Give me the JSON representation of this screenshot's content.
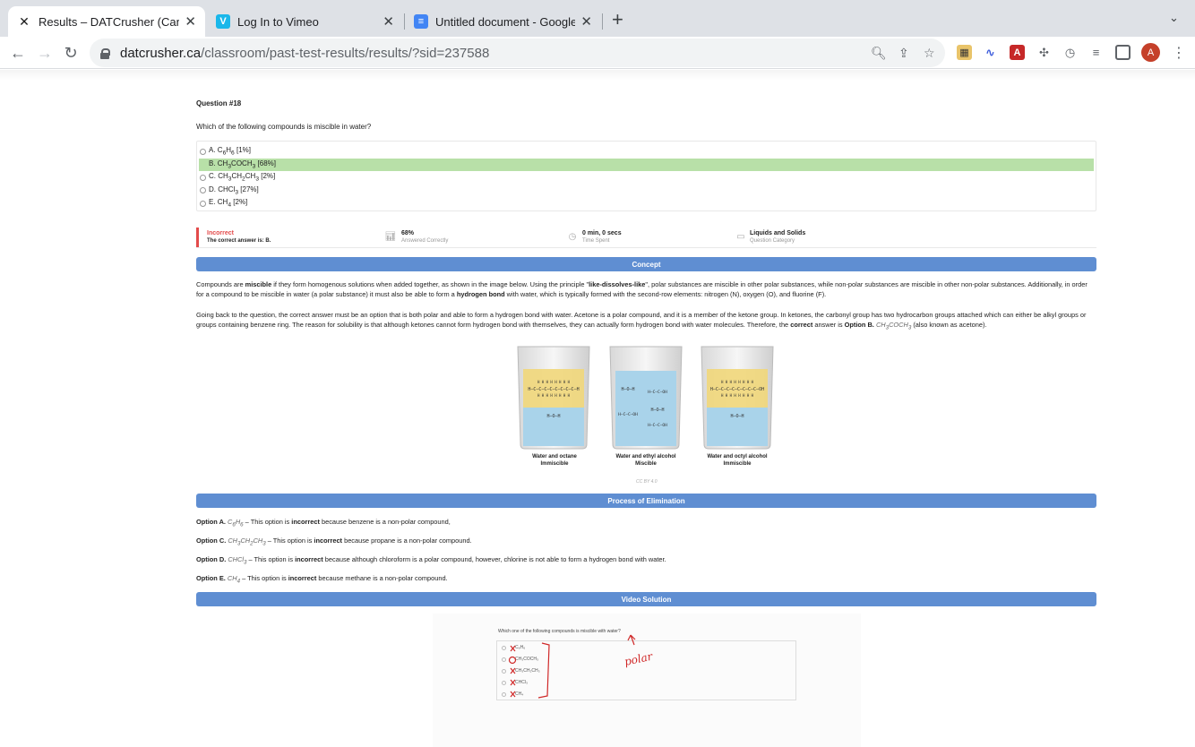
{
  "browser": {
    "tabs": [
      {
        "title": "Results – DATCrusher (Canadia",
        "active": true,
        "icon": "datcrusher-icon",
        "color": "#1a1a1a"
      },
      {
        "title": "Log In to Vimeo",
        "active": false,
        "icon": "vimeo-icon",
        "color": "#1ab7ea"
      },
      {
        "title": "Untitled document - Google Do",
        "active": false,
        "icon": "google-docs-icon",
        "color": "#4285f4"
      }
    ],
    "url_host": "datcrusher.ca",
    "url_path": "/classroom/past-test-results/results/?sid=237588",
    "avatar_letter": "A"
  },
  "question": {
    "number": "Question #18",
    "text": "Which of the following compounds is miscible in water?",
    "choices": [
      {
        "letter": "A.",
        "formula_html": "C<sub>6</sub>H<sub>6</sub>",
        "pct": "[1%]",
        "correct": false
      },
      {
        "letter": "B.",
        "formula_html": "CH<sub>3</sub>COCH<sub>3</sub>",
        "pct": "[68%]",
        "correct": true
      },
      {
        "letter": "C.",
        "formula_html": "CH<sub>3</sub>CH<sub>2</sub>CH<sub>3</sub>",
        "pct": "[2%]",
        "correct": false
      },
      {
        "letter": "D.",
        "formula_html": "CHCl<sub>3</sub>",
        "pct": "[27%]",
        "correct": false
      },
      {
        "letter": "E.",
        "formula_html": "CH<sub>4</sub>",
        "pct": "[2%]",
        "correct": false
      }
    ]
  },
  "result": {
    "status": "Incorrect",
    "correct_answer": "The correct answer is: B.",
    "pct_value": "68%",
    "pct_label": "Answered Correctly",
    "time_value": "0 min, 0 secs",
    "time_label": "Time Spent",
    "category_value": "Liquids and Solids",
    "category_label": "Question Category"
  },
  "sections": {
    "concept": "Concept",
    "elimination": "Process of Elimination",
    "video": "Video Solution"
  },
  "concept_paragraphs": {
    "p1": "Compounds are <b>miscible</b> if they form homogenous solutions when added together, as shown in the image below. Using the principle \"<b>like-dissolves-like</b>\", polar substances are miscible in other polar substances, while non-polar substances are miscible in other non-polar substances. Additionally, in order for a compound to be miscible in water (a polar substance) it must also be able to form a <b>hydrogen bond</b> with water, which is typically formed with the second-row elements: nitrogen (N), oxygen (O), and fluorine (F).",
    "p2": "Going back to the question, the correct answer must be an option that is both polar and able to form a hydrogen bond with water. Acetone is a polar compound, and it is a member of the ketone group. In ketones, the carbonyl group has two hydrocarbon groups attached which can either be alkyl groups or groups containing benzene ring. The reason for solubility is that although ketones cannot form hydrogen bond with themselves, they can actually form hydrogen bond with water molecules. Therefore, the <b>correct</b> answer is <b>Option B.</b> <i>CH<sub>3</sub>COCH<sub>3</sub></i> (also known as acetone)."
  },
  "figure": {
    "beakers": [
      {
        "caption1": "Water and octane",
        "caption2": "Immiscible"
      },
      {
        "caption1": "Water and ethyl alcohol",
        "caption2": "Miscible"
      },
      {
        "caption1": "Water and octyl alcohol",
        "caption2": "Immiscible"
      }
    ],
    "water_label": "H–O–H",
    "credit": "CC BY 4.0"
  },
  "elimination": [
    {
      "label": "Option A.",
      "html": "<i>C<sub>6</sub>H<sub>6</sub></i> –  This option is <b>incorrect</b> because benzene is a non-polar compound,"
    },
    {
      "label": "Option C.",
      "html": "<i>CH<sub>3</sub>CH<sub>2</sub>CH<sub>3</sub></i> – This option is <b>incorrect</b> because propane is a non-polar compound."
    },
    {
      "label": "Option D.",
      "html": "<i>CHCl<sub>3</sub></i> – This option is <b>incorrect</b> because although chloroform is a polar compound, however, chlorine is not able to form a hydrogen bond with water."
    },
    {
      "label": "Option E.",
      "html": "<i>CH<sub>4</sub></i> – This option is <b>incorrect</b> because methane is a non-polar compound."
    }
  ],
  "video": {
    "question": "Which one of the following compounds is miscible with water?",
    "options": [
      "C₆H₆",
      "CH₃COCH₃",
      "CH₃CH₂CH₃",
      "CHCl₃",
      "CH₄"
    ],
    "annotation": "polar"
  },
  "colors": {
    "banner": "#5f8ed2",
    "correct_highlight": "#b8e0a8",
    "incorrect": "#e34b4b"
  }
}
